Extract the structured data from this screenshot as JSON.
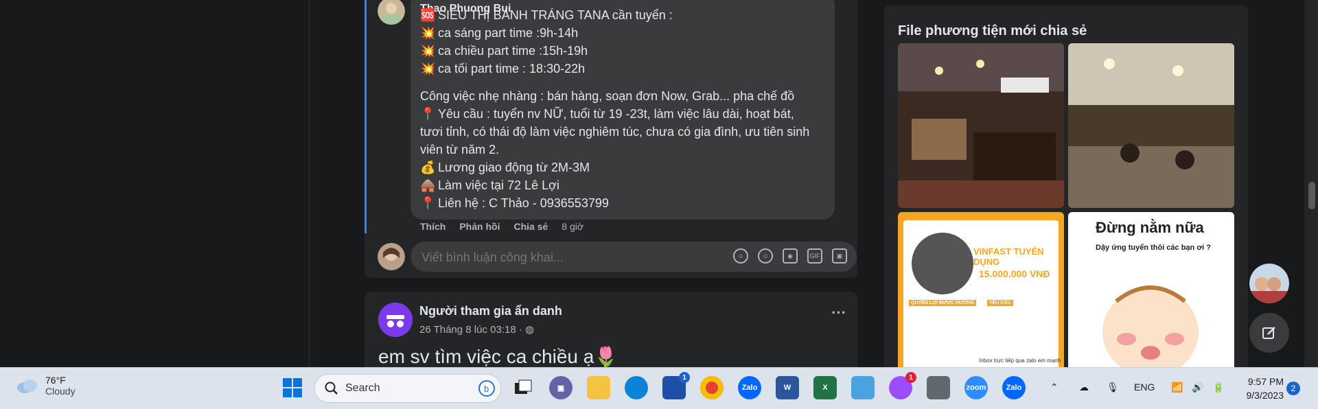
{
  "post": {
    "author": "Thao Phuong Bui",
    "lines": [
      {
        "emoji": "🆘",
        "text": "SIÊU THỊ BÁNH TRÁNG TANA cần tuyển :"
      },
      {
        "emoji": "💥",
        "text": "ca sáng part time :9h-14h"
      },
      {
        "emoji": "💥",
        "text": "ca chiều part time :15h-19h"
      },
      {
        "emoji": "💥",
        "text": "ca tối part time : 18:30-22h"
      }
    ],
    "body": [
      {
        "emoji": "",
        "text": "Công việc nhẹ nhàng : bán hàng, soạn đơn Now, Grab... pha chế đồ"
      },
      {
        "emoji": "📍",
        "text": "Yêu cầu : tuyển nv NỮ, tuổi từ 19 -23t, làm việc lâu dài, hoạt bát,"
      },
      {
        "emoji": "",
        "text": "tươi tỉnh, có thái độ làm việc nghiêm túc, chưa có gia đình, ưu tiên sinh"
      },
      {
        "emoji": "",
        "text": "viên từ năm 2."
      },
      {
        "emoji": "💰",
        "text": "Lương giao động từ 2M-3M"
      },
      {
        "emoji": "🛖",
        "text": "Làm việc tại 72 Lê Lợi"
      },
      {
        "emoji": "📍",
        "text": "Liên hệ : C Thảo - 0936553799"
      }
    ],
    "actions": {
      "like": "Thích",
      "reply": "Phản hồi",
      "share": "Chia sẻ",
      "time": "8 giờ"
    }
  },
  "comment": {
    "placeholder": "Viết bình luận công khai...",
    "icons": [
      "sticker-icon",
      "emoji-icon",
      "camera-icon",
      "gif-icon",
      "sticker2-icon"
    ],
    "gif_label": "GIF"
  },
  "post2": {
    "author": "Người tham gia ẩn danh",
    "time": "26 Tháng 8 lúc 03:18 · ",
    "text": "em sv tìm việc ca chiều ạ🌷",
    "more": "···"
  },
  "media": {
    "title": "File phương tiện mới chia sẻ",
    "items": [
      {
        "label": ""
      },
      {
        "label": ""
      },
      {
        "label": "VINFAST TUYỂN DỤNG",
        "sub": "15.000.000 VNĐ",
        "left_head": "QUYỀN LỢI ĐƯỢC HƯỞNG",
        "right_head": "YÊU CẦU",
        "footer": "Inbox trực tiếp qua zalo em mạnh"
      },
      {
        "label": "Đừng nằm nữa",
        "sub": "Dậy ứng tuyển thôi các bạn ơi ?"
      }
    ]
  },
  "taskbar": {
    "weather": {
      "temp": "76°F",
      "condition": "Cloudy"
    },
    "search_label": "Search",
    "apps": [
      {
        "name": "gallery",
        "badge": ""
      },
      {
        "name": "teams",
        "badge": ""
      },
      {
        "name": "file-explorer",
        "badge": ""
      },
      {
        "name": "edge",
        "badge": ""
      },
      {
        "name": "store",
        "badge": "1"
      },
      {
        "name": "chrome",
        "badge": ""
      },
      {
        "name": "zalo",
        "badge": ""
      },
      {
        "name": "word",
        "badge": ""
      },
      {
        "name": "excel",
        "badge": ""
      },
      {
        "name": "notepad",
        "badge": ""
      },
      {
        "name": "messenger",
        "badge": "1"
      },
      {
        "name": "calculator",
        "badge": ""
      },
      {
        "name": "zoom",
        "badge": ""
      },
      {
        "name": "zalo-2",
        "badge": ""
      }
    ],
    "app_labels": {
      "zalo": "Zalo",
      "word": "W",
      "excel": "X",
      "zoom": "zoom"
    },
    "lang": "ENG",
    "time": "9:57 PM",
    "date": "9/3/2023",
    "notifications": "2"
  }
}
